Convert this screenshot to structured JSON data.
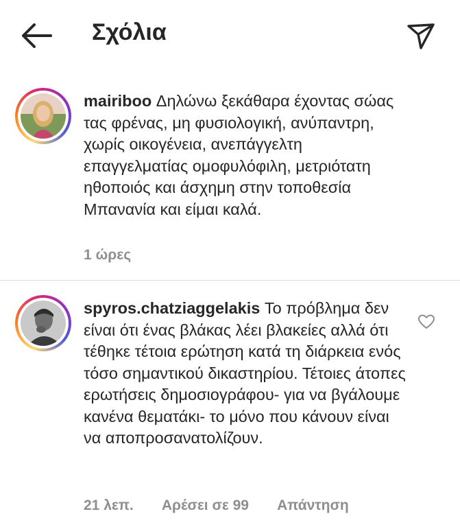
{
  "header": {
    "title": "Σχόλια",
    "back_icon": "arrow-left-icon",
    "send_icon": "paper-plane-icon"
  },
  "comments": [
    {
      "username": "mairiboo",
      "text": "Δηλώνω ξεκάθαρα έχοντας σώας τας φρένας, μη φυσιολογική, ανύπαντρη, χωρίς οικογένεια, ανεπάγγελτη επαγγελματίας ομοφυλόφιλη, μετριότατη ηθοποιός και άσχημη στην τοποθεσία Μπανανία και είμαι καλά.",
      "time": "1 ώρες"
    },
    {
      "username": "spyros.chatziaggelakis",
      "text": "Το πρόβλημα δεν είναι ότι ένας βλάκας λέει βλακείες αλλά ότι τέθηκε τέτοια ερώτηση κατά τη διάρκεια ενός τόσο σημαντικού δικαστηρίου. Τέτοιες άτοπες ερωτήσεις δημοσιογράφου- για να βγάλουμε κανένα θεματάκι- το μόνο που κάνουν είναι να αποπροσανατολίζουν.",
      "time": "21 λεπ.",
      "likes": "Αρέσει σε 99",
      "reply": "Απάντηση"
    }
  ],
  "colors": {
    "text": "#262626",
    "secondary": "#8e8e8e",
    "divider": "#dbdbdb"
  }
}
